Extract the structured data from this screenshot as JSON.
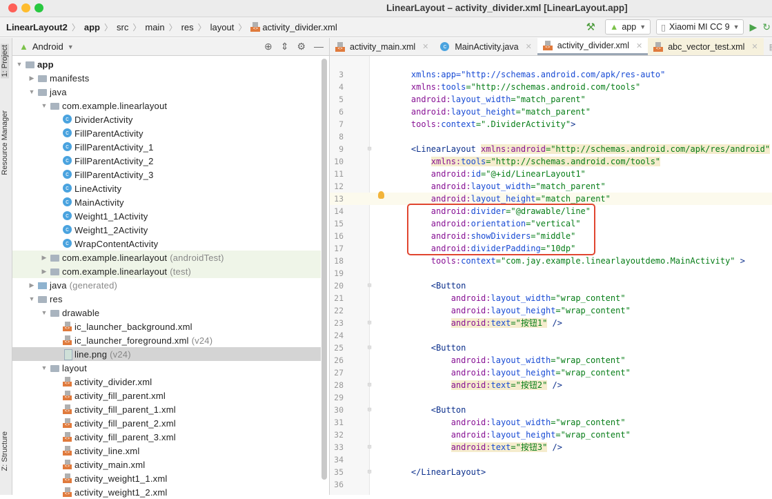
{
  "window": {
    "title": "LinearLayout – activity_divider.xml [LinearLayout.app]"
  },
  "breadcrumb": [
    "LinearLayout2",
    "app",
    "src",
    "main",
    "res",
    "layout",
    "activity_divider.xml"
  ],
  "toolbar": {
    "module": "app",
    "device": "Xiaomi MI CC 9"
  },
  "sidestrip": {
    "project": "1: Project",
    "resource_manager": "Resource Manager",
    "structure": "Z: Structure"
  },
  "project_panel": {
    "view": "Android",
    "tree": [
      {
        "level": 0,
        "arrow": "open",
        "icon": "module",
        "label": "app",
        "bold": true
      },
      {
        "level": 1,
        "arrow": "closed",
        "icon": "folder",
        "label": "manifests"
      },
      {
        "level": 1,
        "arrow": "open",
        "icon": "folder",
        "label": "java"
      },
      {
        "level": 2,
        "arrow": "open",
        "icon": "folder",
        "label": "com.example.linearlayout"
      },
      {
        "level": 3,
        "icon": "class",
        "label": "DividerActivity"
      },
      {
        "level": 3,
        "icon": "class",
        "label": "FillParentActivity"
      },
      {
        "level": 3,
        "icon": "class",
        "label": "FillParentActivity_1"
      },
      {
        "level": 3,
        "icon": "class",
        "label": "FillParentActivity_2"
      },
      {
        "level": 3,
        "icon": "class",
        "label": "FillParentActivity_3"
      },
      {
        "level": 3,
        "icon": "class",
        "label": "LineActivity"
      },
      {
        "level": 3,
        "icon": "class",
        "label": "MainActivity"
      },
      {
        "level": 3,
        "icon": "class",
        "label": "Weight1_1Activity"
      },
      {
        "level": 3,
        "icon": "class",
        "label": "Weight1_2Activity"
      },
      {
        "level": 3,
        "icon": "class",
        "label": "WrapContentActivity"
      },
      {
        "level": 2,
        "arrow": "closed",
        "icon": "folder",
        "label": "com.example.linearlayout",
        "suffix": "(androidTest)",
        "test": true
      },
      {
        "level": 2,
        "arrow": "closed",
        "icon": "folder",
        "label": "com.example.linearlayout",
        "suffix": "(test)",
        "test": true
      },
      {
        "level": 1,
        "arrow": "closed",
        "icon": "generated",
        "label": "java",
        "suffix": "(generated)"
      },
      {
        "level": 1,
        "arrow": "open",
        "icon": "folder",
        "label": "res"
      },
      {
        "level": 2,
        "arrow": "open",
        "icon": "folder",
        "label": "drawable"
      },
      {
        "level": 3,
        "icon": "xml",
        "label": "ic_launcher_background.xml"
      },
      {
        "level": 3,
        "icon": "xml",
        "label": "ic_launcher_foreground.xml",
        "suffix": "(v24)"
      },
      {
        "level": 3,
        "icon": "png",
        "label": "line.png",
        "suffix": "(v24)",
        "selected": true
      },
      {
        "level": 2,
        "arrow": "open",
        "icon": "folder",
        "label": "layout"
      },
      {
        "level": 3,
        "icon": "xml",
        "label": "activity_divider.xml"
      },
      {
        "level": 3,
        "icon": "xml",
        "label": "activity_fill_parent.xml"
      },
      {
        "level": 3,
        "icon": "xml",
        "label": "activity_fill_parent_1.xml"
      },
      {
        "level": 3,
        "icon": "xml",
        "label": "activity_fill_parent_2.xml"
      },
      {
        "level": 3,
        "icon": "xml",
        "label": "activity_fill_parent_3.xml"
      },
      {
        "level": 3,
        "icon": "xml",
        "label": "activity_line.xml"
      },
      {
        "level": 3,
        "icon": "xml",
        "label": "activity_main.xml"
      },
      {
        "level": 3,
        "icon": "xml",
        "label": "activity_weight1_1.xml"
      },
      {
        "level": 3,
        "icon": "xml",
        "label": "activity_weight1_2.xml"
      }
    ]
  },
  "tabs": [
    {
      "label": "activity_main.xml",
      "icon": "xml"
    },
    {
      "label": "MainActivity.java",
      "icon": "class"
    },
    {
      "label": "activity_divider.xml",
      "icon": "xml",
      "active": true
    },
    {
      "label": "abc_vector_test.xml",
      "icon": "xml",
      "modified": true
    }
  ],
  "editor": {
    "caret_line": 13,
    "lines": [
      {
        "n": 3,
        "s": [
          [
            "an",
            "    xmlns:app=\"http://schemas.android.com/apk/res-auto\""
          ]
        ]
      },
      {
        "n": 4,
        "s": [
          [
            "ns",
            "    xmlns:"
          ],
          [
            "an",
            "tools"
          ],
          [
            "val",
            "=\"http://schemas.android.com/tools\""
          ]
        ]
      },
      {
        "n": 5,
        "s": [
          [
            "ns",
            "    android:"
          ],
          [
            "an",
            "layout_width"
          ],
          [
            "val",
            "=\"match_parent\""
          ]
        ]
      },
      {
        "n": 6,
        "s": [
          [
            "ns",
            "    android:"
          ],
          [
            "an",
            "layout_height"
          ],
          [
            "val",
            "=\"match_parent\""
          ]
        ]
      },
      {
        "n": 7,
        "s": [
          [
            "ns",
            "    tools:"
          ],
          [
            "an",
            "context"
          ],
          [
            "val",
            "=\".DividerActivity\""
          ],
          [
            "tag",
            ">"
          ]
        ]
      },
      {
        "n": 8,
        "s": []
      },
      {
        "n": 9,
        "fold": true,
        "s": [
          [
            "tag",
            "    <LinearLayout "
          ],
          [
            "hl-ns",
            "xmlns:"
          ],
          [
            "hl-ns",
            "android"
          ],
          [
            "hl-val",
            "=\"http://schemas.android.com/apk/res/android\""
          ]
        ]
      },
      {
        "n": 10,
        "s": [
          [
            "pl",
            "        "
          ],
          [
            "hl-ns",
            "xmlns:"
          ],
          [
            "hl-an",
            "tools"
          ],
          [
            "hl-val",
            "=\"http://schemas.android.com/tools\""
          ]
        ]
      },
      {
        "n": 11,
        "s": [
          [
            "ns",
            "        android:"
          ],
          [
            "an",
            "id"
          ],
          [
            "val",
            "=\"@+id/LinearLayout1\""
          ]
        ]
      },
      {
        "n": 12,
        "s": [
          [
            "ns",
            "        android:"
          ],
          [
            "an",
            "layout_width"
          ],
          [
            "val",
            "=\"match_parent\""
          ]
        ]
      },
      {
        "n": 13,
        "s": [
          [
            "ns",
            "        android:"
          ],
          [
            "an",
            "layout_height"
          ],
          [
            "val",
            "=\"match_parent\""
          ]
        ]
      },
      {
        "n": 14,
        "s": [
          [
            "ns",
            "        android:"
          ],
          [
            "an",
            "divider"
          ],
          [
            "val",
            "=\"@drawable/line\""
          ]
        ]
      },
      {
        "n": 15,
        "s": [
          [
            "ns",
            "        android:"
          ],
          [
            "an",
            "orientation"
          ],
          [
            "val",
            "=\"vertical\""
          ]
        ]
      },
      {
        "n": 16,
        "s": [
          [
            "ns",
            "        android:"
          ],
          [
            "an",
            "showDividers"
          ],
          [
            "val",
            "=\"middle\""
          ]
        ]
      },
      {
        "n": 17,
        "s": [
          [
            "ns",
            "        android:"
          ],
          [
            "an",
            "dividerPadding"
          ],
          [
            "val",
            "=\"10dp\""
          ]
        ]
      },
      {
        "n": 18,
        "s": [
          [
            "ns",
            "        tools:"
          ],
          [
            "an",
            "context"
          ],
          [
            "val",
            "=\"com.jay.example.linearlayoutdemo.MainActivity\""
          ],
          [
            "tag",
            " >"
          ]
        ]
      },
      {
        "n": 19,
        "s": []
      },
      {
        "n": 20,
        "fold": true,
        "s": [
          [
            "tag",
            "        <Button"
          ]
        ]
      },
      {
        "n": 21,
        "s": [
          [
            "ns",
            "            android:"
          ],
          [
            "an",
            "layout_width"
          ],
          [
            "val",
            "=\"wrap_content\""
          ]
        ]
      },
      {
        "n": 22,
        "s": [
          [
            "ns",
            "            android:"
          ],
          [
            "an",
            "layout_height"
          ],
          [
            "val",
            "=\"wrap_content\""
          ]
        ]
      },
      {
        "n": 23,
        "fold": true,
        "s": [
          [
            "pl",
            "            "
          ],
          [
            "hl-ns",
            "android:"
          ],
          [
            "hl-an",
            "text"
          ],
          [
            "hl-val",
            "=\"按钮1\""
          ],
          [
            "tag",
            " />"
          ]
        ]
      },
      {
        "n": 24,
        "s": []
      },
      {
        "n": 25,
        "fold": true,
        "s": [
          [
            "tag",
            "        <Button"
          ]
        ]
      },
      {
        "n": 26,
        "s": [
          [
            "ns",
            "            android:"
          ],
          [
            "an",
            "layout_width"
          ],
          [
            "val",
            "=\"wrap_content\""
          ]
        ]
      },
      {
        "n": 27,
        "s": [
          [
            "ns",
            "            android:"
          ],
          [
            "an",
            "layout_height"
          ],
          [
            "val",
            "=\"wrap_content\""
          ]
        ]
      },
      {
        "n": 28,
        "fold": true,
        "s": [
          [
            "pl",
            "            "
          ],
          [
            "hl-ns",
            "android:"
          ],
          [
            "hl-an",
            "text"
          ],
          [
            "hl-val",
            "=\"按钮2\""
          ],
          [
            "tag",
            " />"
          ]
        ]
      },
      {
        "n": 29,
        "s": []
      },
      {
        "n": 30,
        "fold": true,
        "s": [
          [
            "tag",
            "        <Button"
          ]
        ]
      },
      {
        "n": 31,
        "s": [
          [
            "ns",
            "            android:"
          ],
          [
            "an",
            "layout_width"
          ],
          [
            "val",
            "=\"wrap_content\""
          ]
        ]
      },
      {
        "n": 32,
        "s": [
          [
            "ns",
            "            android:"
          ],
          [
            "an",
            "layout_height"
          ],
          [
            "val",
            "=\"wrap_content\""
          ]
        ]
      },
      {
        "n": 33,
        "fold": true,
        "s": [
          [
            "pl",
            "            "
          ],
          [
            "hl-ns",
            "android:"
          ],
          [
            "hl-an",
            "text"
          ],
          [
            "hl-val",
            "=\"按钮3\""
          ],
          [
            "tag",
            " />"
          ]
        ]
      },
      {
        "n": 34,
        "s": []
      },
      {
        "n": 35,
        "fold": true,
        "s": [
          [
            "tag",
            "    </LinearLayout>"
          ]
        ]
      },
      {
        "n": 36,
        "s": []
      }
    ]
  },
  "colors": {
    "highlight_box": "#e0452f",
    "attr_namespace": "#871094",
    "attr_name": "#174ad4",
    "value": "#067d17",
    "tag": "#0b2f8c"
  }
}
